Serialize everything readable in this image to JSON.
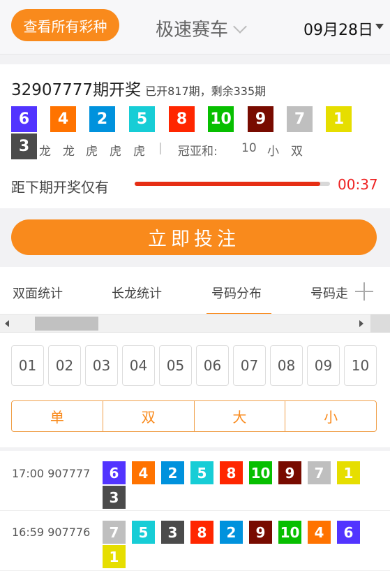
{
  "header": {
    "all_lotteries_label": "查看所有彩种",
    "game_title": "极速赛车",
    "date": "09月28日"
  },
  "current_draw": {
    "period_title": "32907777期开奖",
    "period_status": "已开817期，剩余335期",
    "balls": [
      "6",
      "4",
      "2",
      "5",
      "8",
      "10",
      "9",
      "7",
      "1",
      "3"
    ],
    "dragon_tiger": [
      "龙",
      "龙",
      "虎",
      "虎",
      "虎"
    ],
    "separator": "|",
    "sum_label": "冠亚和:",
    "sum_value": "10",
    "size": "小",
    "parity": "双"
  },
  "countdown": {
    "label": "距下期开奖仅有",
    "time": "00:37",
    "progress": 0.95
  },
  "bet_button_label": "立即投注",
  "tabs": [
    "双面统计",
    "长龙统计",
    "号码分布",
    "号码走"
  ],
  "active_tab": "号码分布",
  "numbers": [
    "01",
    "02",
    "03",
    "04",
    "05",
    "06",
    "07",
    "08",
    "09",
    "10"
  ],
  "filters": [
    "单",
    "双",
    "大",
    "小"
  ],
  "history": [
    {
      "time_period": "17:00 907777",
      "balls": [
        "6",
        "4",
        "2",
        "5",
        "8",
        "10",
        "9",
        "7",
        "1",
        "3"
      ]
    },
    {
      "time_period": "16:59 907776",
      "balls": [
        "7",
        "5",
        "3",
        "8",
        "2",
        "9",
        "10",
        "4",
        "6",
        "1"
      ]
    }
  ],
  "ball_colors": {
    "1": "#e6de00",
    "2": "#0092dd",
    "3": "#4b4b4b",
    "4": "#ff7300",
    "5": "#17cdd6",
    "6": "#5234ff",
    "7": "#bfbfbf",
    "8": "#ff2600",
    "9": "#780b00",
    "10": "#07bf00"
  },
  "colors": {
    "accent": "#f98a1c",
    "countdown": "#e22222"
  }
}
